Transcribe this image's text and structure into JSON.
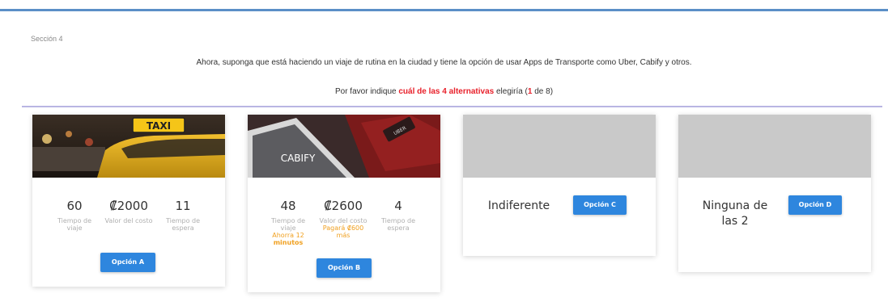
{
  "section": {
    "label": "Sección 4"
  },
  "intro": {
    "line1": "Ahora, suponga que está haciendo un viaje de rutina en la ciudad y tiene la opción de usar Apps de Transporte como Uber, Cabify y otros.",
    "line2_prefix": "Por favor indique ",
    "line2_highlight": "cuál de las 4 alternativas",
    "line2_mid": " elegiría (",
    "line2_current": "1",
    "line2_suffix": " de 8)"
  },
  "cards": {
    "a": {
      "image_sign": "TAXI",
      "stats": [
        {
          "value": "60",
          "label": "Tiempo de viaje"
        },
        {
          "value": "₡2000",
          "label": "Valor del costo"
        },
        {
          "value": "11",
          "label": "Tiempo de espera"
        }
      ],
      "button": "Opción A"
    },
    "b": {
      "image_logo": "CABIFY",
      "image_small": "UBER",
      "stats": [
        {
          "value": "48",
          "label": "Tiempo de viaje",
          "note": "Ahorra 12",
          "note_bold": "minutos"
        },
        {
          "value": "₡2600",
          "label": "Valor del costo",
          "note": "Pagará ₡600 más"
        },
        {
          "value": "4",
          "label": "Tiempo de espera"
        }
      ],
      "button": "Opción B"
    },
    "c": {
      "text": "Indiferente",
      "button": "Opción C"
    },
    "d": {
      "text": "Ninguna de las 2",
      "button": "Opción D"
    }
  },
  "colors": {
    "accent": "#2e86de",
    "highlight": "#e8202a",
    "note": "#f0a020",
    "divider": "#b9b5e3"
  }
}
